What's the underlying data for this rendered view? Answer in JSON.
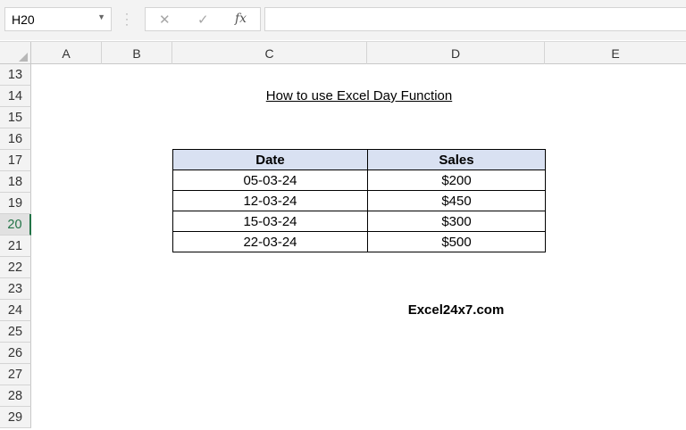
{
  "formula_bar": {
    "name_box": "H20",
    "cancel_icon": "✕",
    "enter_icon": "✓",
    "fx_label": "fx",
    "formula": ""
  },
  "columns": [
    "A",
    "B",
    "C",
    "D",
    "E"
  ],
  "rows": [
    "13",
    "14",
    "15",
    "16",
    "17",
    "18",
    "19",
    "20",
    "21",
    "22",
    "23",
    "24",
    "25",
    "26",
    "27",
    "28",
    "29"
  ],
  "selected_row": "20",
  "sheet": {
    "title": "How to use Excel Day Function",
    "table": {
      "headers": [
        "Date",
        "Sales"
      ],
      "rows": [
        [
          "05-03-24",
          "$200"
        ],
        [
          "12-03-24",
          "$450"
        ],
        [
          "15-03-24",
          "$300"
        ],
        [
          "22-03-24",
          "$500"
        ]
      ]
    },
    "brand": "Excel24x7.com"
  },
  "colors": {
    "header_fill": "#d9e1f2",
    "selection": "#217346"
  }
}
